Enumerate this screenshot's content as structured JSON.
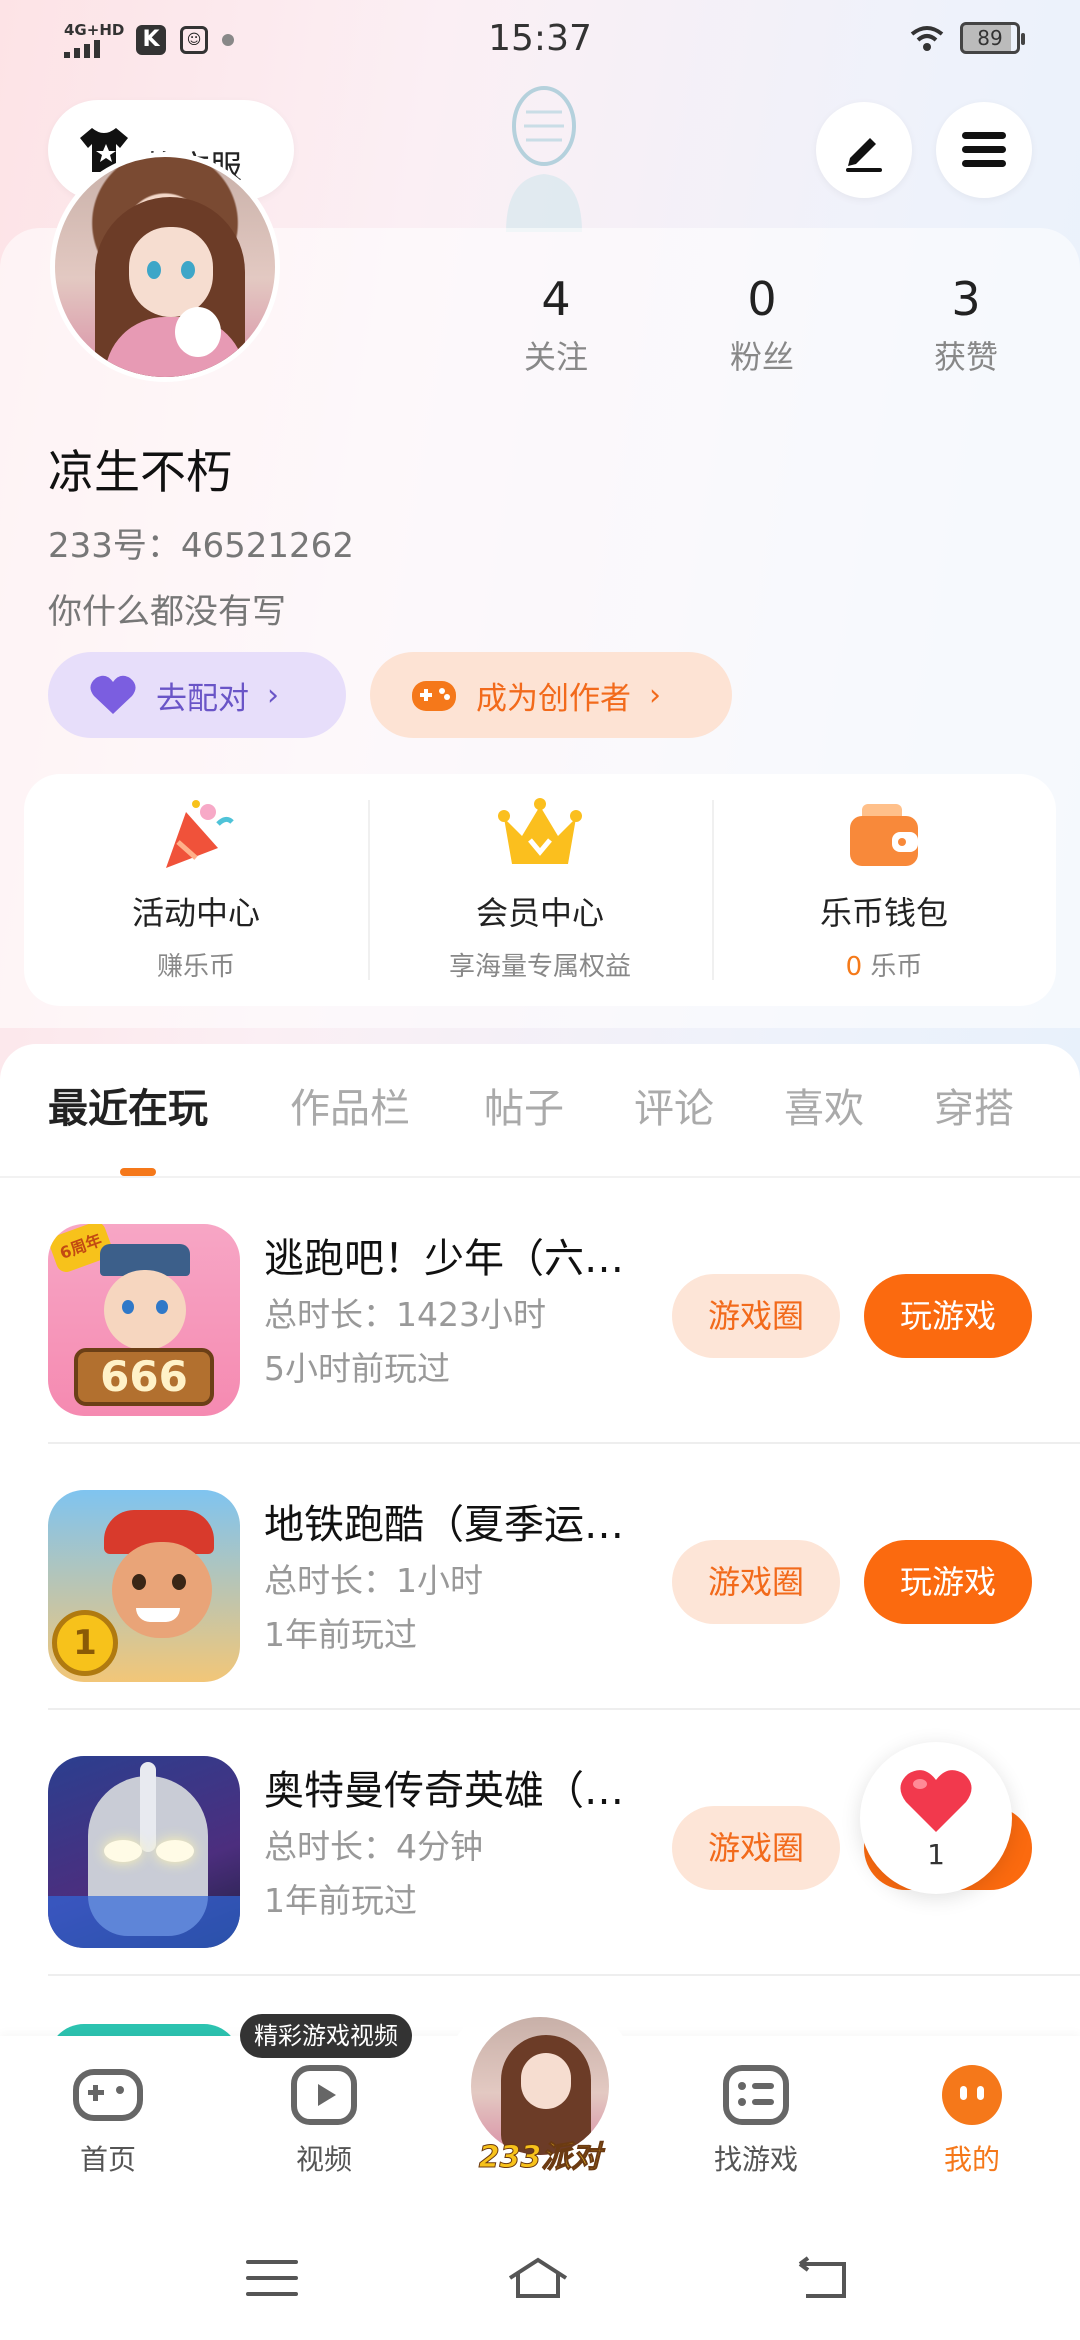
{
  "status_bar": {
    "network": "4G+HD",
    "time": "15:37",
    "battery": "89",
    "app_badge": "K"
  },
  "header": {
    "dress_label": "换衣服"
  },
  "profile": {
    "stats": [
      {
        "value": "4",
        "label": "关注"
      },
      {
        "value": "0",
        "label": "粉丝"
      },
      {
        "value": "3",
        "label": "获赞"
      }
    ],
    "username": "凉生不朽",
    "uid": "233号：46521262",
    "bio": "你什么都没有写",
    "match_button": "去配对",
    "creator_button": "成为创作者"
  },
  "quick_actions": [
    {
      "title": "活动中心",
      "subtitle": "赚乐币"
    },
    {
      "title": "会员中心",
      "subtitle": "享海量专属权益"
    },
    {
      "title": "乐币钱包",
      "subtitle_value": "0",
      "subtitle_unit": " 乐币"
    }
  ],
  "tabs": [
    "最近在玩",
    "作品栏",
    "帖子",
    "评论",
    "喜欢",
    "穿搭"
  ],
  "games": [
    {
      "name": "逃跑吧！少年（六…",
      "duration": "总时长：1423小时",
      "last_played": "5小时前玩过",
      "circle_label": "游戏圈",
      "play_label": "玩游戏",
      "icon_badge": "6周年",
      "icon_text": "666"
    },
    {
      "name": "地铁跑酷（夏季运…",
      "duration": "总时长：1小时",
      "last_played": "1年前玩过",
      "circle_label": "游戏圈",
      "play_label": "玩游戏",
      "icon_text": "1"
    },
    {
      "name": "奥特曼传奇英雄（…",
      "duration": "总时长：4分钟",
      "last_played": "1年前玩过",
      "circle_label": "游戏圈",
      "play_label": "玩游戏"
    }
  ],
  "like_float": {
    "count": "1"
  },
  "bottom_nav": {
    "video_tip": "精彩游戏视频",
    "items": [
      {
        "label": "首页"
      },
      {
        "label": "视频"
      },
      {
        "label": "233派对"
      },
      {
        "label": "找游戏"
      },
      {
        "label": "我的"
      }
    ]
  },
  "colors": {
    "accent": "#fb6a0f",
    "match_purple": "#6a55c7"
  }
}
